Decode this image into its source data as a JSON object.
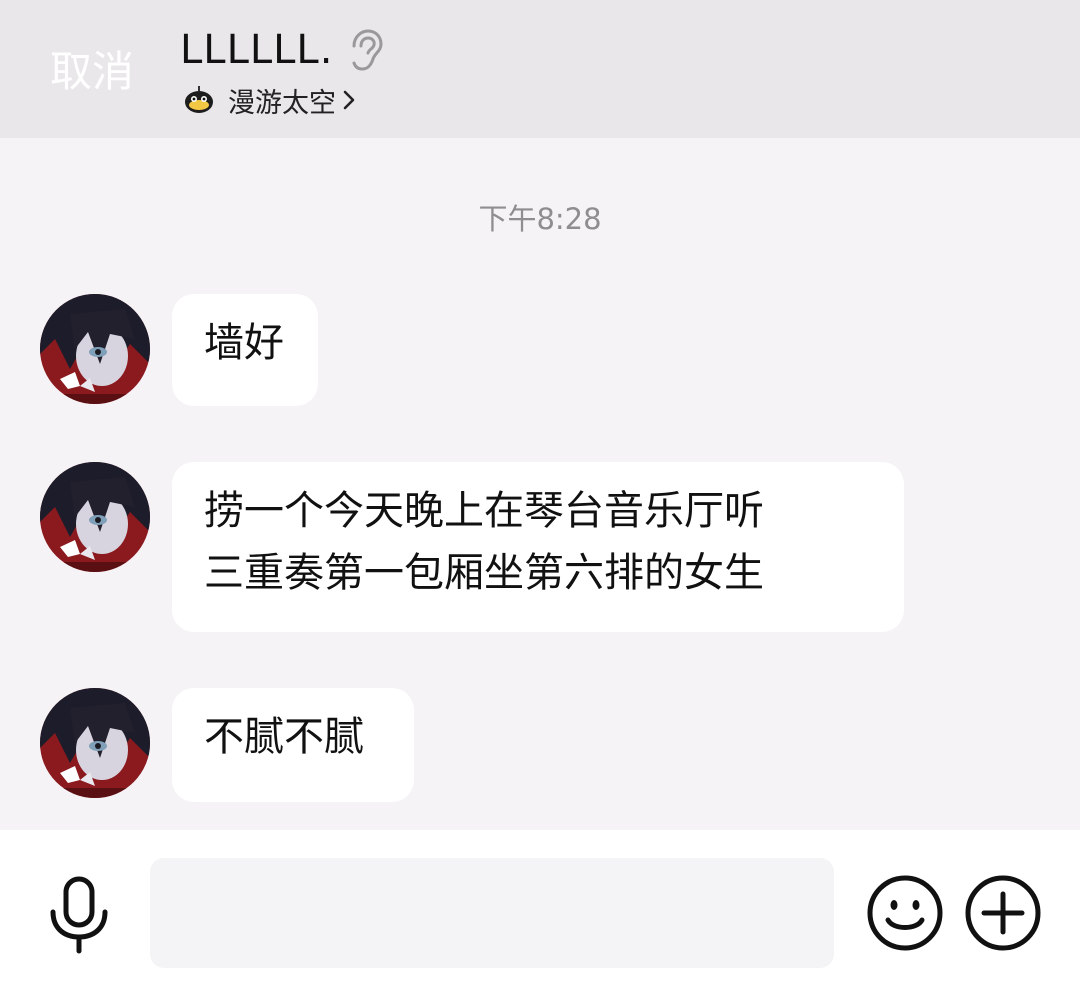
{
  "header": {
    "cancel_label": "取消",
    "contact_name": "LLLLLL.",
    "status_text": "漫游太空"
  },
  "chat": {
    "timestamp": "下午8:28",
    "messages": [
      {
        "lines": [
          "墙好"
        ]
      },
      {
        "lines": [
          "捞一个今天晚上在琴台音乐厅听",
          "三重奏第一包厢坐第六排的女生"
        ]
      },
      {
        "lines": [
          "不腻不腻"
        ]
      }
    ]
  },
  "input": {
    "value": "",
    "placeholder": ""
  },
  "icons": {
    "ear": "ear-icon",
    "status": "robot-icon",
    "mic": "mic-icon",
    "emoji": "smile-icon",
    "plus": "plus-icon"
  },
  "colors": {
    "header_bg": "#eae7ea",
    "chat_bg": "#f5f3f6",
    "bubble_bg": "#ffffff",
    "timestamp": "#8f8d90"
  }
}
